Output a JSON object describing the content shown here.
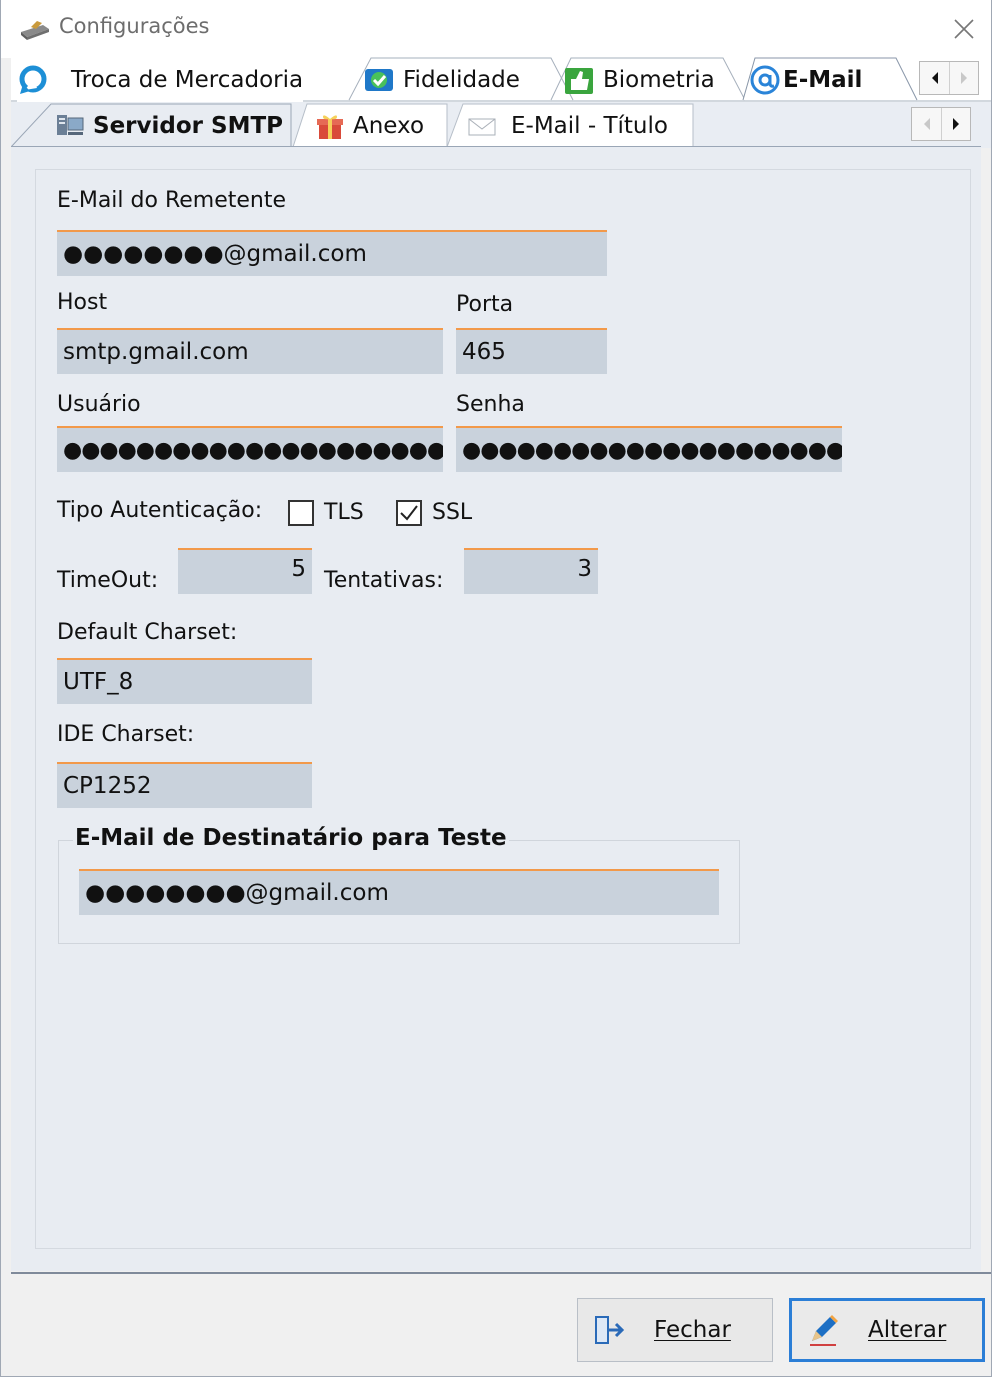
{
  "window": {
    "title": "Configurações"
  },
  "tabs_row1": [
    {
      "label": "Troca de Mercadoria",
      "icon": "refresh-icon"
    },
    {
      "label": "Fidelidade",
      "icon": "loyalty-icon"
    },
    {
      "label": "Biometria",
      "icon": "thumbs-up-icon"
    },
    {
      "label": "E-Mail",
      "icon": "at-icon",
      "active": true
    }
  ],
  "tabs_row2": [
    {
      "label": "Servidor SMTP",
      "icon": "server-icon",
      "active": true
    },
    {
      "label": "Anexo",
      "icon": "gift-icon"
    },
    {
      "label": "E-Mail - Título",
      "icon": "envelope-icon"
    }
  ],
  "form": {
    "sender_label": "E-Mail do Remetente",
    "sender_value": "●●●●●●●●@gmail.com",
    "host_label": "Host",
    "host_value": "smtp.gmail.com",
    "port_label": "Porta",
    "port_value": "465",
    "user_label": "Usuário",
    "user_value": "●●●●●●●●●●●●●●●●●●●●●●●●",
    "password_label": "Senha",
    "password_value": "●●●●●●●●●●●●●●●●●●●●●●●●",
    "auth_label": "Tipo Autenticação:",
    "tls_label": "TLS",
    "tls_checked": false,
    "ssl_label": "SSL",
    "ssl_checked": true,
    "timeout_label": "TimeOut:",
    "timeout_value": "5",
    "attempts_label": "Tentativas:",
    "attempts_value": "3",
    "default_charset_label": "Default Charset:",
    "default_charset_value": "UTF_8",
    "ide_charset_label": "IDE Charset:",
    "ide_charset_value": "CP1252",
    "test_group_title": "E-Mail de Destinatário para Teste",
    "test_value": "●●●●●●●●@gmail.com"
  },
  "footer": {
    "close_label": "Fechar",
    "edit_label": "Alterar"
  },
  "colors": {
    "accent": "#f2994a",
    "field_bg": "#c9d2dc",
    "panel_bg": "#e8ecf2",
    "focus_border": "#2b7ed6"
  }
}
